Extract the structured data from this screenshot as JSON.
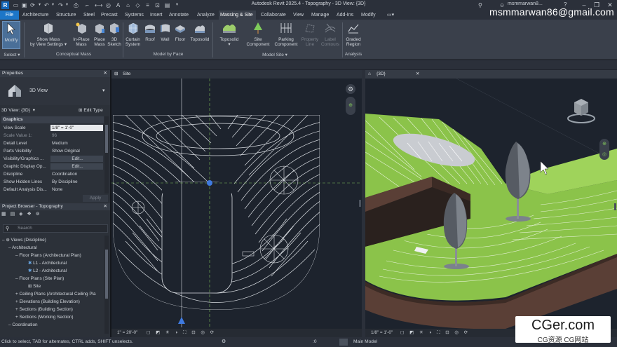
{
  "titlebar": {
    "title": "Autodesk Revit 2025.4 - Topography - 3D View: {3D}",
    "user": "msmmarwan8..."
  },
  "tabs": [
    "File",
    "Architecture",
    "Structure",
    "Steel",
    "Precast",
    "Systems",
    "Insert",
    "Annotate",
    "Analyze",
    "Massing & Site",
    "Collaborate",
    "View",
    "Manage",
    "Add-Ins",
    "Modify"
  ],
  "active_tab": "Massing & Site",
  "overlay_email": "msmmarwan86@gmail.com",
  "ribbon": {
    "modify": "Modify",
    "select": "Select ▾",
    "show_mass_1": "Show Mass",
    "show_mass_2": "by View Settings ▾",
    "inplace_1": "In-Place",
    "inplace_2": "Mass",
    "place_1": "Place",
    "place_2": "Mass",
    "sketch_1": "3D",
    "sketch_2": "Sketch",
    "curtain_1": "Curtain",
    "curtain_2": "System",
    "roof": "Roof",
    "wall": "Wall",
    "floor": "Floor",
    "toposolid_face": "Toposolid",
    "toposolid": "Toposolid",
    "site_comp_1": "Site",
    "site_comp_2": "Component",
    "parking_1": "Parking",
    "parking_2": "Component",
    "property_1": "Property",
    "property_2": "Line",
    "label_1": "Label",
    "label_2": "Contours",
    "graded_1": "Graded",
    "graded_2": "Region",
    "group_conceptual": "Conceptual Mass",
    "group_model_face": "Model by Face",
    "group_model_site": "Model Site ▾",
    "group_analysis": "Analysis"
  },
  "properties": {
    "header": "Properties",
    "type_name": "3D View",
    "view_selector": "3D View: {3D}",
    "edit_type": "Edit Type",
    "section": "Graphics",
    "rows": [
      {
        "k": "View Scale",
        "v": "1/8\" = 1'-0\""
      },
      {
        "k": "Scale Value   1:",
        "v": "96"
      },
      {
        "k": "Detail Level",
        "v": "Medium"
      },
      {
        "k": "Parts Visibility",
        "v": "Show Original"
      },
      {
        "k": "Visibility/Graphics ...",
        "v": "Edit..."
      },
      {
        "k": "Graphic Display Op...",
        "v": "Edit..."
      },
      {
        "k": "Discipline",
        "v": "Coordination"
      },
      {
        "k": "Show Hidden Lines",
        "v": "By Discipline"
      },
      {
        "k": "Default Analysis Dis...",
        "v": "None"
      }
    ],
    "apply": "Apply"
  },
  "browser": {
    "header": "Project Browser - Topography",
    "search_placeholder": "Search",
    "items": [
      {
        "label": "Views (Discipline)",
        "indent": 0
      },
      {
        "label": "Architectural",
        "indent": 1
      },
      {
        "label": "Floor Plans (Architectural Plan)",
        "indent": 2
      },
      {
        "label": "L1 - Architectural",
        "indent": 3
      },
      {
        "label": "L2 - Architectural",
        "indent": 3
      },
      {
        "label": "Floor Plans (Site Plan)",
        "indent": 2
      },
      {
        "label": "Site",
        "indent": 3
      },
      {
        "label": "Ceiling Plans (Architectural Ceiling Pla",
        "indent": 2
      },
      {
        "label": "Elevations (Building Elevation)",
        "indent": 2
      },
      {
        "label": "Sections (Building Section)",
        "indent": 2
      },
      {
        "label": "Sections (Working Section)",
        "indent": 2
      },
      {
        "label": "Coordination",
        "indent": 1
      }
    ]
  },
  "views": {
    "site_tab": "Site",
    "view3d_tab": "{3D}",
    "site_scale": "1\" = 20'-0\"",
    "view3d_scale": "1/8\" = 1'-0\""
  },
  "statusbar": {
    "text": "Click to select, TAB for alternates, CTRL adds, SHIFT unselects.",
    "zero": ":0",
    "model": "Main Model"
  },
  "watermark": {
    "line1": "CGer.com",
    "line2": "CG资源 CG网站"
  }
}
